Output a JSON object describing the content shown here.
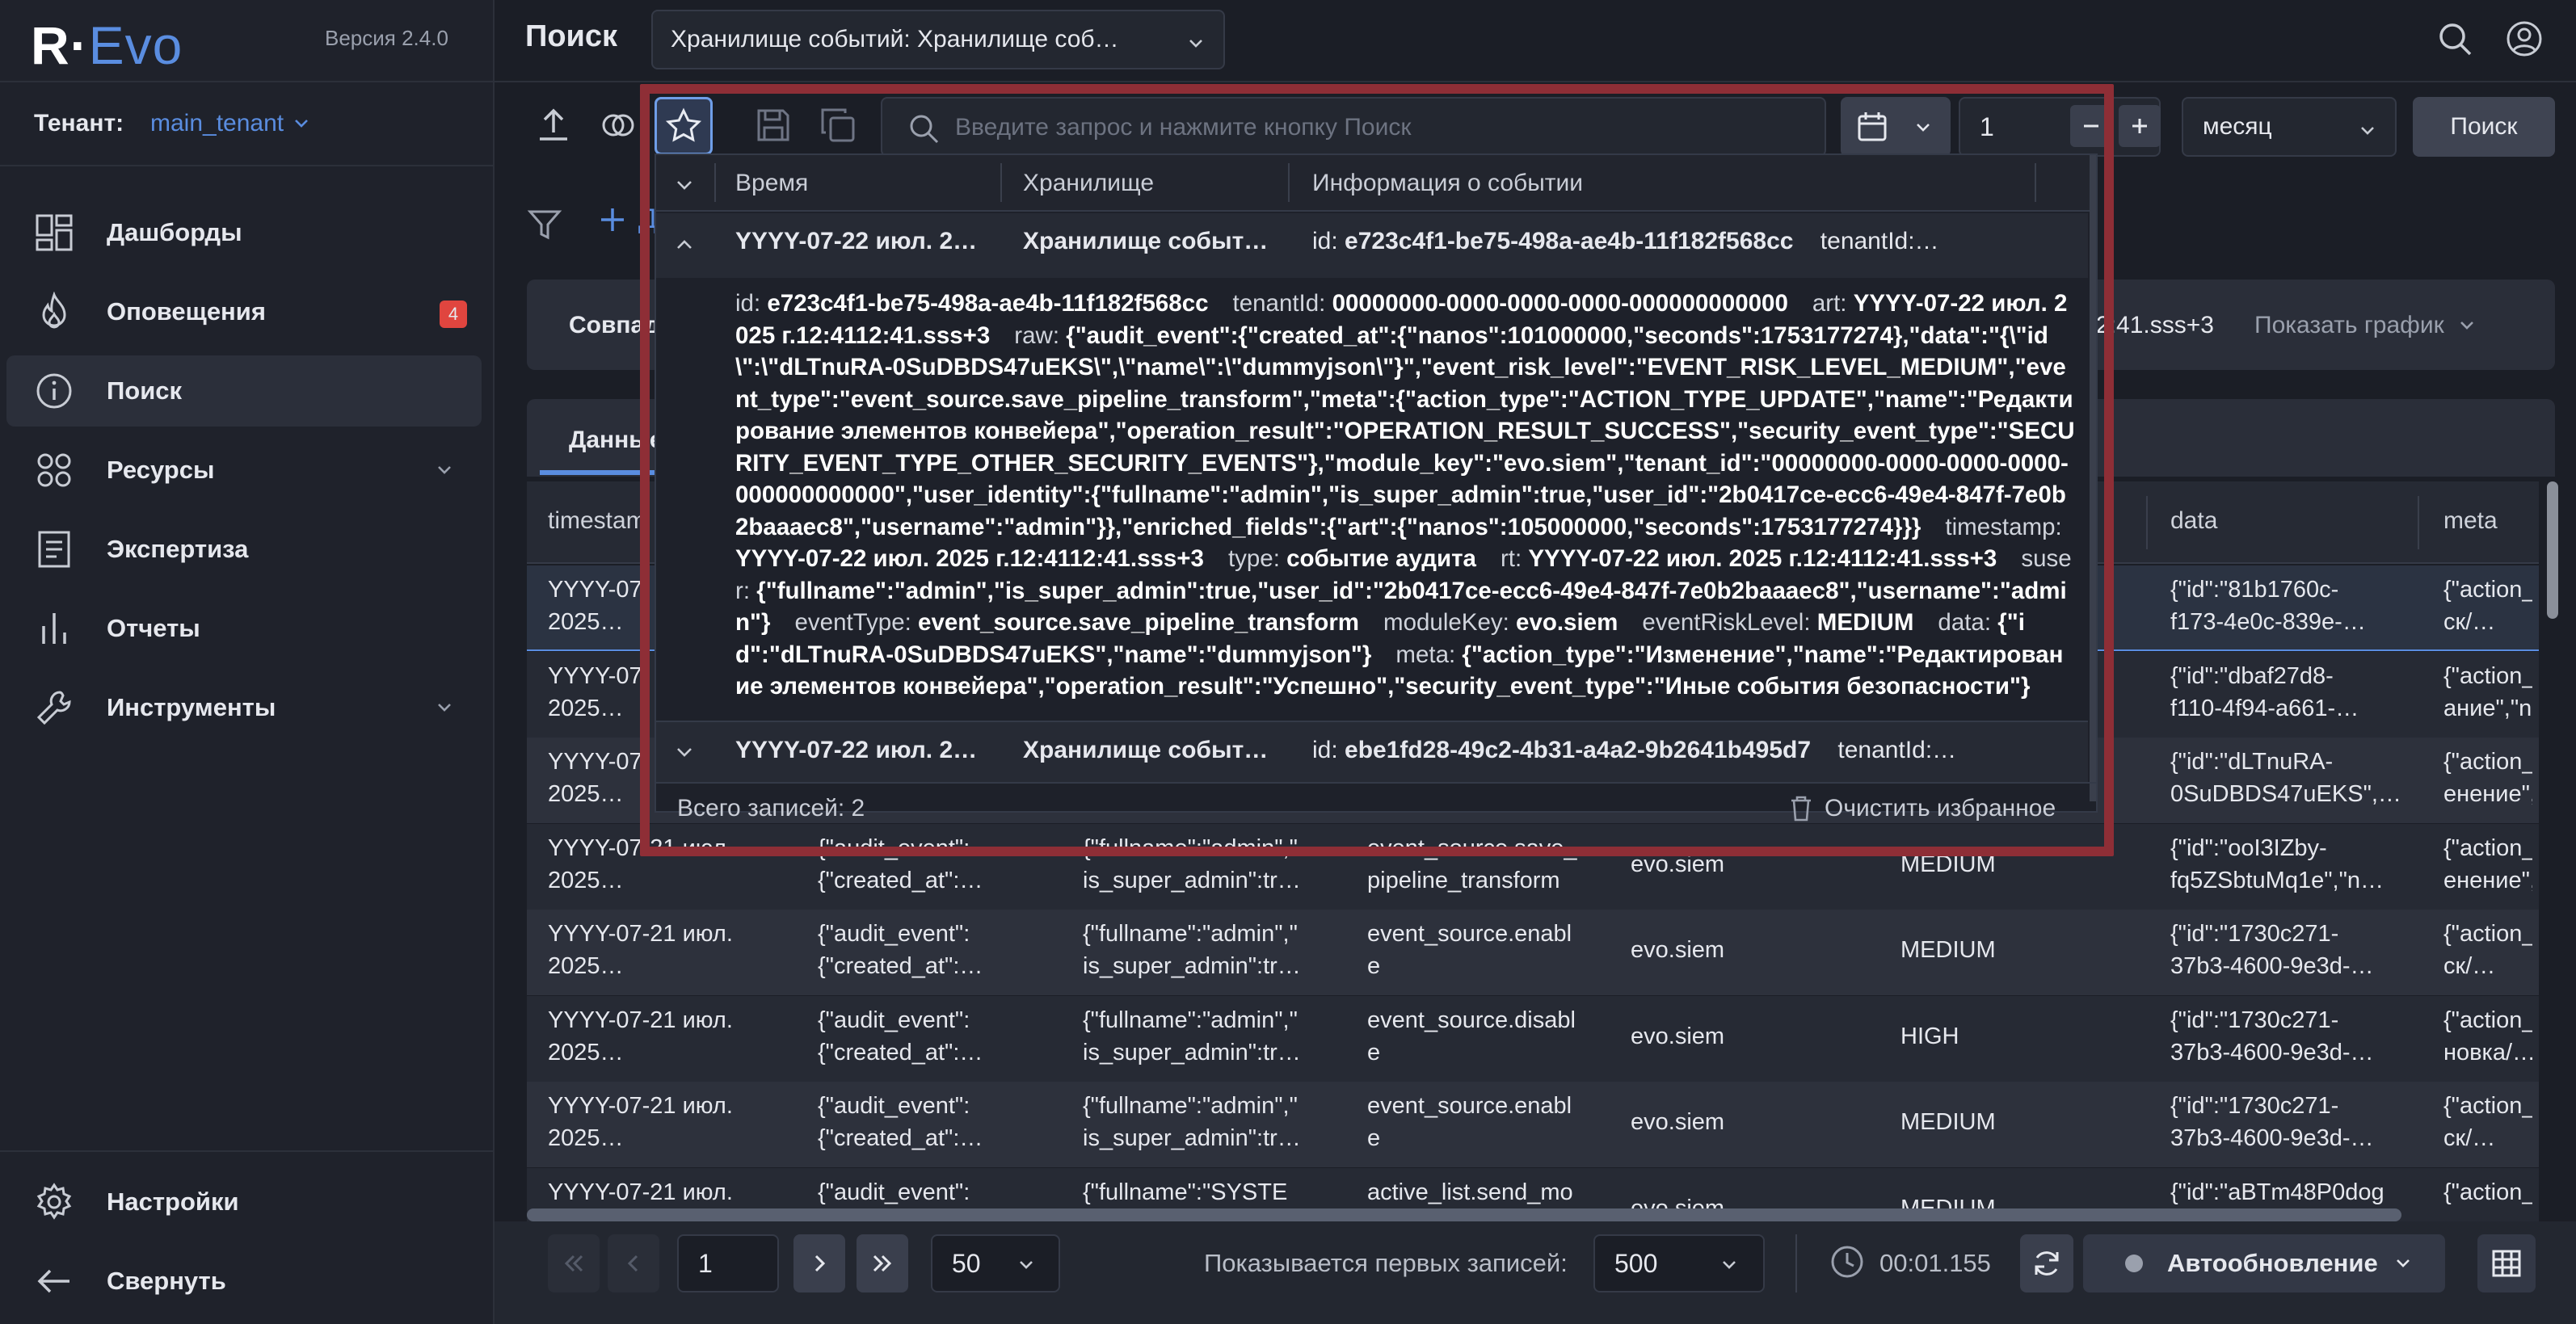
{
  "app": {
    "logo_r": "R·",
    "logo_evo": "Evo",
    "version": "Версия 2.4.0"
  },
  "tenant": {
    "label": "Тенант:",
    "value": "main_tenant"
  },
  "nav": [
    {
      "label": "Дашборды",
      "icon": "dashboard-icon"
    },
    {
      "label": "Оповещения",
      "icon": "flame-icon",
      "badge": "4"
    },
    {
      "label": "Поиск",
      "icon": "info-icon",
      "active": true
    },
    {
      "label": "Ресурсы",
      "icon": "resources-icon",
      "expandable": true
    },
    {
      "label": "Экспертиза",
      "icon": "document-icon"
    },
    {
      "label": "Отчеты",
      "icon": "bar-chart-icon"
    },
    {
      "label": "Инструменты",
      "icon": "wrench-icon",
      "expandable": true
    }
  ],
  "nav_bottom": {
    "settings": "Настройки",
    "collapse": "Свернуть"
  },
  "header": {
    "title": "Поиск",
    "store": "Хранилище событий: Хранилище соб…"
  },
  "toolbar": {
    "search_placeholder": "Введите запрос и нажмите кнопку Поиск",
    "count": "1",
    "period": "месяц",
    "search_button": "Поиск"
  },
  "filter": {
    "add_label": "Д"
  },
  "summary": {
    "match_label": "Совпад",
    "time_range": "2:41.sss+3",
    "show_chart": "Показать график"
  },
  "tabs": {
    "active": "Данные"
  },
  "table": {
    "headers": {
      "timestamp": "timestam",
      "data": "data",
      "meta": "meta"
    },
    "rows": [
      {
        "c1": "YYYY-07-\n2025…",
        "data": "{\"id\":\"81b1760c-\nf173-4e0c-839e-…",
        "meta": "{\"action_t\nск/…"
      },
      {
        "c1": "YYYY-07-\n2025…",
        "data": "{\"id\":\"dbaf27d8-\nf110-4f94-a661-…",
        "meta": "{\"action_t\nание\",\"na"
      },
      {
        "c1": "YYYY-07-\n2025…",
        "data": "{\"id\":\"dLTnuRA-\n0SuDBDS47uEKS\",…",
        "meta": "{\"action_t\nенение\","
      },
      {
        "c1": "YYYY-07-21 июл.\n2025…",
        "c2": "{\"audit_event\":\n{\"created_at\":…",
        "c3": "{\"fullname\":\"admin\",\"\nis_super_admin\":tr…",
        "c4": "event_source.save_\npipeline_transform",
        "c5": "evo.siem",
        "c6": "MEDIUM",
        "data": "{\"id\":\"ooI3IZby-\nfq5ZSbtuMq1e\",\"n…",
        "meta": "{\"action_t\nенение\","
      },
      {
        "c1": "YYYY-07-21 июл.\n2025…",
        "c2": "{\"audit_event\":\n{\"created_at\":…",
        "c3": "{\"fullname\":\"admin\",\"\nis_super_admin\":tr…",
        "c4": "event_source.enabl\ne",
        "c5": "evo.siem",
        "c6": "MEDIUM",
        "data": "{\"id\":\"1730c271-\n37b3-4600-9e3d-…",
        "meta": "{\"action_t\nск/…"
      },
      {
        "c1": "YYYY-07-21 июл.\n2025…",
        "c2": "{\"audit_event\":\n{\"created_at\":…",
        "c3": "{\"fullname\":\"admin\",\"\nis_super_admin\":tr…",
        "c4": "event_source.disabl\ne",
        "c5": "evo.siem",
        "c6": "HIGH",
        "data": "{\"id\":\"1730c271-\n37b3-4600-9e3d-…",
        "meta": "{\"action_t\nновка/…"
      },
      {
        "c1": "YYYY-07-21 июл.\n2025…",
        "c2": "{\"audit_event\":\n{\"created_at\":…",
        "c3": "{\"fullname\":\"admin\",\"\nis_super_admin\":tr…",
        "c4": "event_source.enabl\ne",
        "c5": "evo.siem",
        "c6": "MEDIUM",
        "data": "{\"id\":\"1730c271-\n37b3-4600-9e3d-…",
        "meta": "{\"action_t\nск/…"
      },
      {
        "c1": "YYYY-07-21 июл.\n2025…",
        "c2": "{\"audit_event\":\n{\"created_at\":…",
        "c3": "{\"fullname\":\"SYSTE\n",
        "c4": "active_list.send_mo\n",
        "c5": "evo.siem",
        "c6": "MEDIUM",
        "data": "{\"id\":\"aBTm48P0dog\n",
        "meta": "{\"action_t\n"
      }
    ]
  },
  "bottom": {
    "page": "1",
    "page_size": "50",
    "shown_label": "Показывается первых записей:",
    "shown_value": "500",
    "timer": "00:01.155",
    "auto_refresh": "Автообновление"
  },
  "favorites": {
    "headers": {
      "time": "Время",
      "store": "Хранилище",
      "info": "Информация о событии"
    },
    "row1": {
      "time": "YYYY-07-22 июл. 2…",
      "store": "Хранилище событ…",
      "info_label": "id:",
      "info_id": "e723c4f1-be75-498a-ae4b-11f182f568cc",
      "info_tail": "tenantId:…"
    },
    "detail": [
      {
        "k": "id:",
        "v": "e723c4f1-be75-498a-ae4b-11f182f568cc"
      },
      {
        "k": "tenantId:",
        "v": "00000000-0000-0000-0000-000000000000"
      },
      {
        "k": "art:",
        "v": "YYYY-07-22 июл. 2025 г.12:4112:41.sss+3"
      },
      {
        "k": "raw:",
        "v": "{\"audit_event\":{\"created_at\":{\"nanos\":101000000,\"seconds\":1753177274},\"data\":\"{\\\"id\\\":\\\"dLTnuRA-0SuDBDS47uEKS\\\",\\\"name\\\":\\\"dummyjson\\\"}\",\"event_risk_level\":\"EVENT_RISK_LEVEL_MEDIUM\",\"event_type\":\"event_source.save_pipeline_transform\",\"meta\":{\"action_type\":\"ACTION_TYPE_UPDATE\",\"name\":\"Редактирование элементов конвейера\",\"operation_result\":\"OPERATION_RESULT_SUCCESS\",\"security_event_type\":\"SECURITY_EVENT_TYPE_OTHER_SECURITY_EVENTS\"},\"module_key\":\"evo.siem\",\"tenant_id\":\"00000000-0000-0000-0000-000000000000\",\"user_identity\":{\"fullname\":\"admin\",\"is_super_admin\":true,\"user_id\":\"2b0417ce-ecc6-49e4-847f-7e0b2baaaec8\",\"username\":\"admin\"}},\"enriched_fields\":{\"art\":{\"nanos\":105000000,\"seconds\":1753177274}}}"
      },
      {
        "k": "timestamp:",
        "v": "YYYY-07-22 июл. 2025 г.12:4112:41.sss+3"
      },
      {
        "k": "type:",
        "v": "событие аудита"
      },
      {
        "k": "rt:",
        "v": "YYYY-07-22 июл. 2025 г.12:4112:41.sss+3"
      },
      {
        "k": "suser:",
        "v": "{\"fullname\":\"admin\",\"is_super_admin\":true,\"user_id\":\"2b0417ce-ecc6-49e4-847f-7e0b2baaaec8\",\"username\":\"admin\"}"
      },
      {
        "k": "eventType:",
        "v": "event_source.save_pipeline_transform"
      },
      {
        "k": "moduleKey:",
        "v": "evo.siem"
      },
      {
        "k": "eventRiskLevel:",
        "v": "MEDIUM"
      },
      {
        "k": "data:",
        "v": "{\"id\":\"dLTnuRA-0SuDBDS47uEKS\",\"name\":\"dummyjson\"}"
      },
      {
        "k": "meta:",
        "v": "{\"action_type\":\"Изменение\",\"name\":\"Редактирование элементов конвейера\",\"operation_result\":\"Успешно\",\"security_event_type\":\"Иные события безопасности\"}"
      }
    ],
    "row2": {
      "time": "YYYY-07-22 июл. 2…",
      "store": "Хранилище событ…",
      "info_label": "id:",
      "info_id": "ebe1fd28-49c2-4b31-a4a2-9b2641b495d7",
      "info_tail": "tenantId:…"
    },
    "total": "Всего записей: 2",
    "clear": "Очистить избранное"
  },
  "colors": {
    "accent": "#5a8de0",
    "badge": "#e0453f",
    "highlight_outline": "#8e2e36"
  }
}
